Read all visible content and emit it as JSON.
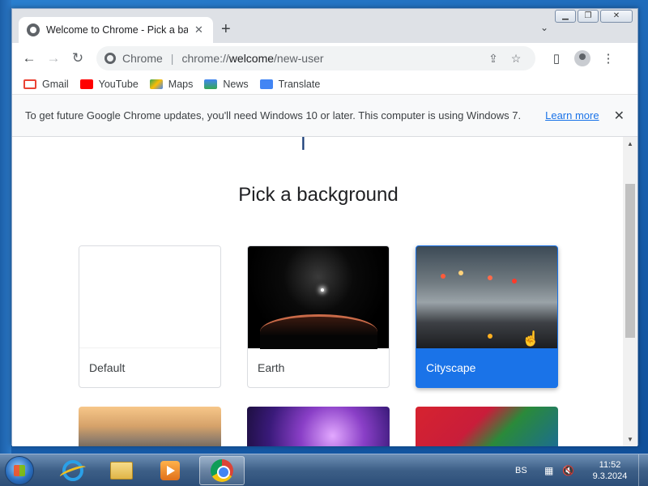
{
  "browser": {
    "tab_title": "Welcome to Chrome - Pick a bac",
    "tab_close": "✕",
    "new_tab": "+",
    "tab_search": "⌄",
    "omnibox": {
      "scheme_label": "Chrome",
      "separator": "|",
      "url_prefix": "chrome://",
      "url_host": "welcome",
      "url_path": "/new-user"
    },
    "bookmarks": [
      {
        "label": "Gmail",
        "color": "#ea4335"
      },
      {
        "label": "YouTube",
        "color": "#ff0000"
      },
      {
        "label": "Maps",
        "color": "#34a853"
      },
      {
        "label": "News",
        "color": "#4285f4"
      },
      {
        "label": "Translate",
        "color": "#4285f4"
      }
    ],
    "infobar": {
      "message": "To get future Google Chrome updates, you'll need Windows 10 or later. This computer is using Windows 7.",
      "link": "Learn more",
      "close": "✕"
    }
  },
  "page": {
    "heading": "Pick a background",
    "cards": [
      {
        "label": "Default",
        "selected": false
      },
      {
        "label": "Earth",
        "selected": false
      },
      {
        "label": "Cityscape",
        "selected": true
      }
    ]
  },
  "taskbar": {
    "language": "BS",
    "time": "11:52",
    "date": "9.3.2024"
  },
  "colors": {
    "accent": "#1a73e8",
    "taskbar": "#3d5f87"
  }
}
